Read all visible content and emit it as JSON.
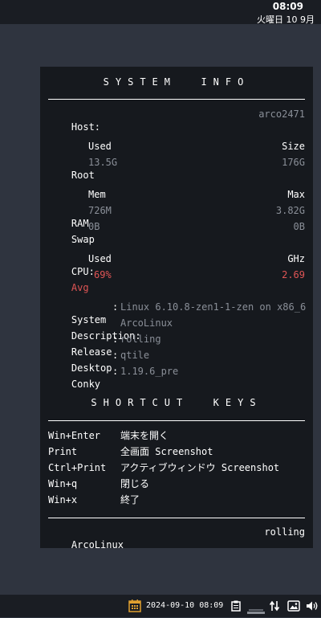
{
  "topbar": {
    "time": "08:09",
    "date": "火曜日 10 9月"
  },
  "conky": {
    "system_header": "SYSTEM  INFO",
    "host_label": "Host:",
    "host_value": "arco2471",
    "root_used_hdr": "Used",
    "root_size_hdr": "Size",
    "root_label": "Root",
    "root_used": "13.5G",
    "root_size": "176G",
    "mem_hdr": "Mem",
    "max_hdr": "Max",
    "ram_label": "RAM",
    "ram_used": "726M",
    "ram_max": "3.82G",
    "swap_label": "Swap",
    "swap_used": "0B",
    "swap_max": "0B",
    "cpu_label": "CPU:",
    "cpu_used_hdr": "Used",
    "cpu_ghz_hdr": "GHz",
    "avg_label": "Avg",
    "avg_used": "69%",
    "avg_ghz": "2.69",
    "system_label": "System",
    "system_value": "Linux 6.10.8-zen1-1-zen on x86_6",
    "description_label": "Description:",
    "description_value": "ArcoLinux",
    "release_label": "Release",
    "release_value": "rolling",
    "desktop_label": "Desktop",
    "desktop_value": "qtile",
    "conky_label": "Conky",
    "conky_value": "1.19.6_pre",
    "colon": ":",
    "shortcut_header": "SHORTCUT  KEYS",
    "shortcuts": [
      {
        "key": "Win+Enter",
        "action": "端末を開く"
      },
      {
        "key": "Print",
        "action": "全画面 Screenshot"
      },
      {
        "key": "Ctrl+Print",
        "action": "アクティブウィンドウ Screenshot"
      },
      {
        "key": "Win+q",
        "action": "閉じる"
      },
      {
        "key": "Win+x",
        "action": "終了"
      }
    ],
    "footer_left": "ArcoLinux",
    "footer_right": "rolling"
  },
  "bottombar": {
    "datetime": "2024-09-10 08:09",
    "icons": [
      "calendar-icon",
      "clipboard-icon",
      "network-wired-icon",
      "transfer-icon",
      "screenshot-icon",
      "volume-icon"
    ]
  },
  "colors": {
    "accent_red": "#e05555",
    "panel_bg": "#16191e",
    "desktop_bg": "#2f343f"
  }
}
